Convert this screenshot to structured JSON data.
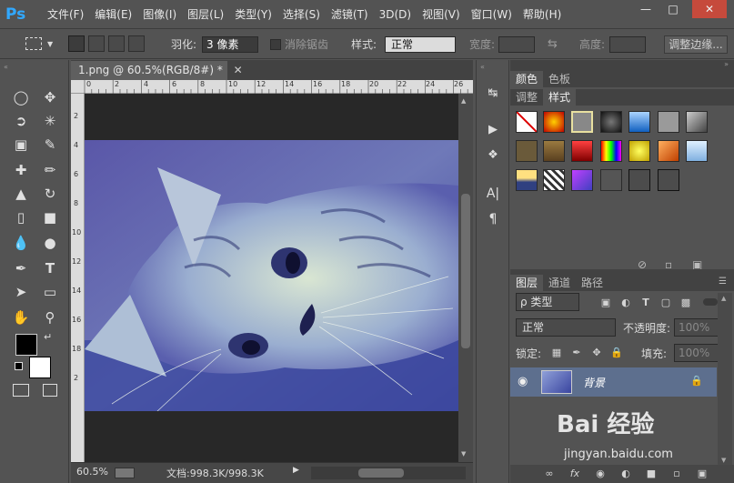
{
  "app": {
    "logo": "Ps"
  },
  "menu": [
    "文件(F)",
    "编辑(E)",
    "图像(I)",
    "图层(L)",
    "类型(Y)",
    "选择(S)",
    "滤镜(T)",
    "3D(D)",
    "视图(V)",
    "窗口(W)",
    "帮助(H)"
  ],
  "options": {
    "feather_label": "羽化:",
    "feather_value": "3 像素",
    "antialias_label": "消除锯齿",
    "style_label": "样式:",
    "style_value": "正常",
    "width_label": "宽度:",
    "height_label": "高度:",
    "refine_edge": "调整边缘..."
  },
  "document": {
    "tab_title": "1.png @ 60.5%(RGB/8#) *",
    "zoom": "60.5%",
    "doc_size": "文档:998.3K/998.3K",
    "ruler_h": [
      "0",
      "2",
      "4",
      "6",
      "8",
      "10",
      "12",
      "14",
      "16",
      "18",
      "20",
      "22",
      "24",
      "26"
    ],
    "ruler_v": [
      "2",
      "4",
      "6",
      "8",
      "10",
      "12",
      "14",
      "16",
      "18",
      "2"
    ]
  },
  "panels": {
    "top_tabs": [
      "颜色",
      "色板"
    ],
    "second_tabs": [
      "调整",
      "样式"
    ],
    "layers_tabs": [
      "图层",
      "通道",
      "路径"
    ],
    "kind_filter": "ρ 类型",
    "blend_mode": "正常",
    "opacity_label": "不透明度:",
    "opacity_value": "100%",
    "lock_label": "锁定:",
    "fill_label": "填充:",
    "fill_value": "100%",
    "layer_name": "背景"
  },
  "watermark": {
    "brand": "Bai 经验",
    "url": "jingyan.baidu.com"
  }
}
